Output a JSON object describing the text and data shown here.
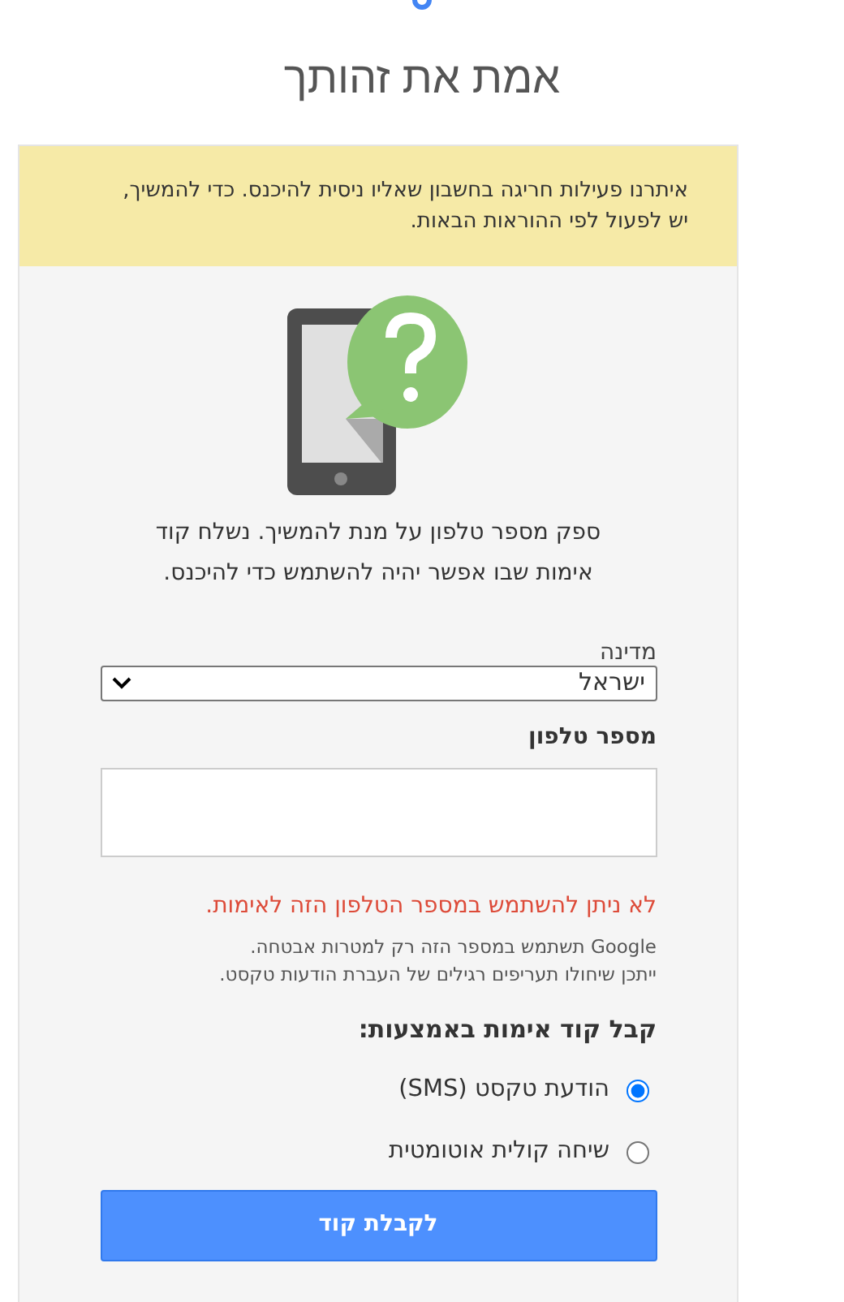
{
  "title": "אמת את זהותך",
  "alert": "איתרנו פעילות חריגה בחשבון שאליו ניסית להיכנס. כדי להמשיך, יש לפעול לפי ההוראות הבאות.",
  "instructions": "ספק מספר טלפון על מנת להמשיך. נשלח קוד אימות שבו אפשר יהיה להשתמש כדי להיכנס.",
  "country": {
    "label": "מדינה",
    "value": "ישראל"
  },
  "phone": {
    "label": "מספר טלפון"
  },
  "error": "לא ניתן להשתמש במספר הטלפון הזה לאימות.",
  "notes": [
    "Google תשתמש במספר הזה רק למטרות אבטחה.",
    "ייתכן שיחולו תעריפים רגילים של העברת הודעות טקסט."
  ],
  "method_heading": "קבל קוד אימות באמצעות:",
  "methods": [
    {
      "label": "הודעת טקסט (SMS)",
      "selected": true
    },
    {
      "label": "שיחה קולית אוטומטית",
      "selected": false
    }
  ],
  "submit": "לקבלת קוד"
}
